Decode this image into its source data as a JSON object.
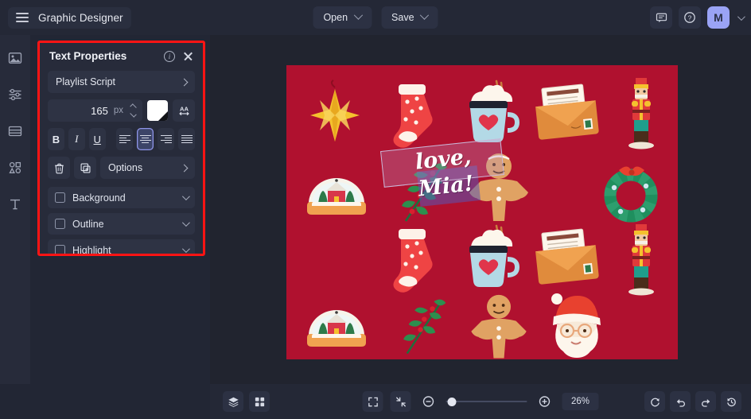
{
  "topbar": {
    "menu_icon": "hamburger-icon",
    "brand": "Graphic Designer",
    "open_label": "Open",
    "save_label": "Save",
    "comment_icon": "comment-icon",
    "help_icon": "help-icon",
    "avatar_initial": "M"
  },
  "rail": {
    "items": [
      {
        "icon": "image-icon",
        "name": "media"
      },
      {
        "icon": "sliders-icon",
        "name": "adjust"
      },
      {
        "icon": "layout-icon",
        "name": "layout"
      },
      {
        "icon": "shapes-icon",
        "name": "shapes"
      },
      {
        "icon": "text-icon",
        "name": "text"
      }
    ]
  },
  "panel": {
    "title": "Text Properties",
    "info_icon": "info-icon",
    "close_icon": "close-icon",
    "font_name": "Playlist Script",
    "font_size": "165",
    "font_size_unit": "px",
    "color_swatch": "#ffffff",
    "spacing_icon": "letter-spacing-icon",
    "bold_label": "B",
    "italic_label": "I",
    "underline_label": "U",
    "align_left": "align-left-icon",
    "align_center": "align-center-icon",
    "align_right": "align-right-icon",
    "align_justify": "align-justify-icon",
    "active_align": "align-center",
    "delete_icon": "trash-icon",
    "duplicate_icon": "duplicate-icon",
    "options_label": "Options",
    "toggles": [
      {
        "label": "Background",
        "checked": false
      },
      {
        "label": "Outline",
        "checked": false
      },
      {
        "label": "Highlight",
        "checked": false
      }
    ],
    "highlight_border_color": "#ff1414"
  },
  "canvas": {
    "background_color": "#b0112f",
    "text_line1": "love,",
    "text_line2": "Mia!",
    "stickers": [
      "star-ornament",
      "stocking",
      "cocoa-mug",
      "envelope-letter",
      "nutcracker",
      "snow-globe",
      "holly-branch",
      "gingerbread-man",
      "wreath",
      "santa-face"
    ]
  },
  "bottombar": {
    "layers_icon": "layers-icon",
    "grid_icon": "grid-icon",
    "fit_icon": "fit-screen-icon",
    "collapse_icon": "collapse-icon",
    "zoom_out_icon": "zoom-out-icon",
    "zoom_in_icon": "zoom-in-icon",
    "zoom_level": "26%",
    "reset_icon": "reset-icon",
    "undo_icon": "undo-icon",
    "redo_icon": "redo-icon",
    "history_icon": "history-icon"
  }
}
